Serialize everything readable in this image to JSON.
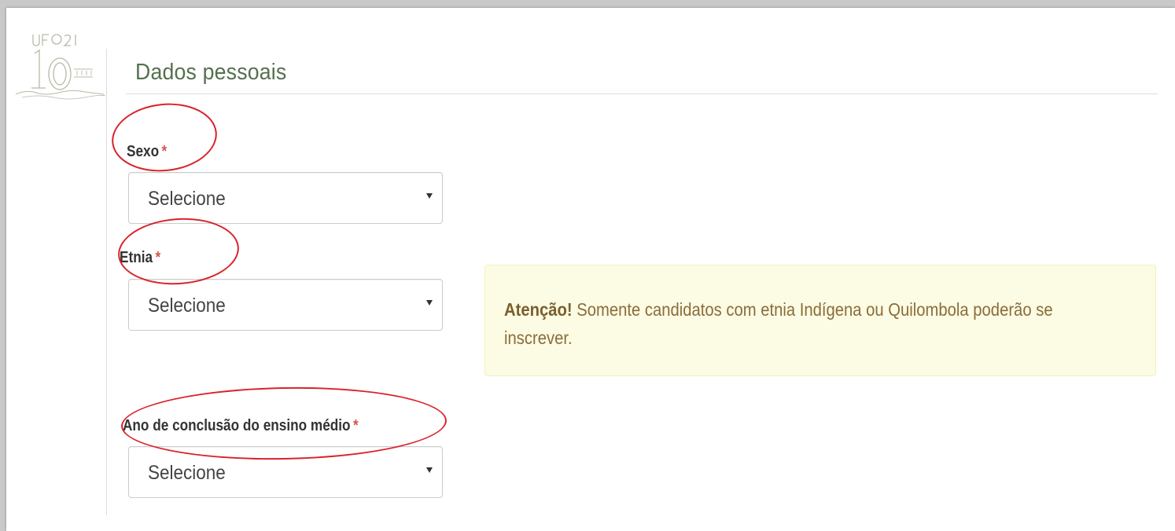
{
  "section": {
    "title": "Dados pessoais"
  },
  "fields": {
    "sexo": {
      "label": "Sexo",
      "required_mark": "*",
      "selected": "Selecione"
    },
    "etnia": {
      "label": "Etnia",
      "required_mark": "*",
      "selected": "Selecione"
    },
    "ano_conclusao": {
      "label": "Ano de conclusão do ensino médio",
      "required_mark": "*",
      "selected": "Selecione"
    }
  },
  "alert": {
    "strong": "Atenção!",
    "text": " Somente candidatos com etnia Indígena ou Quilombola poderão se inscrever."
  },
  "colors": {
    "section_title": "#55704f",
    "required": "#d9534f",
    "alert_background": "#fcfbe3",
    "alert_text": "#8a6d3b",
    "annotation": "#d9232a"
  },
  "icons": {
    "logo": "university-anniversary-logo",
    "dropdown": "caret-down-icon"
  }
}
